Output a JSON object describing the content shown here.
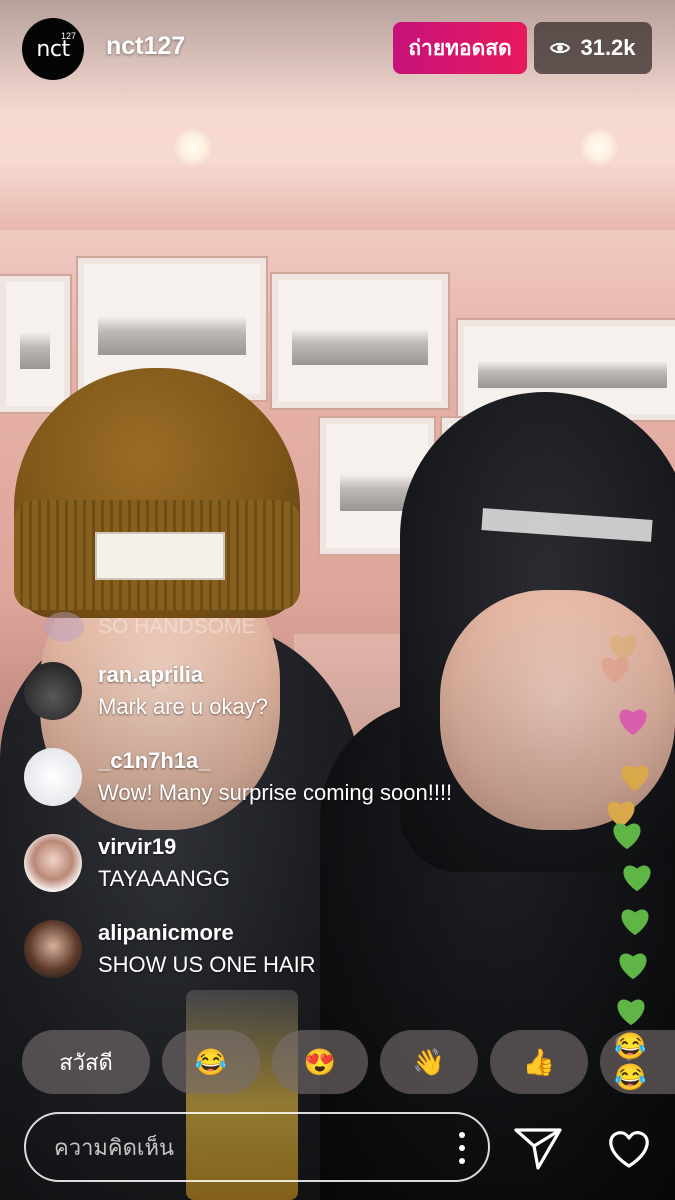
{
  "header": {
    "channel_avatar_text": "nct",
    "channel_avatar_sup": "127",
    "username": "nct127",
    "live_label": "ถ่ายทอดสด",
    "viewer_count": "31.2k",
    "viewer_icon": "eye-icon"
  },
  "faded_comment": "SO HANDSOME",
  "comments": [
    {
      "user": "ran.aprilia",
      "text": "Mark are u okay?"
    },
    {
      "user": "_c1n7h1a_",
      "text": "Wow! Many surprise coming soon!!!!"
    },
    {
      "user": "virvir19",
      "text": "TAYAAANGG"
    },
    {
      "user": "alipanicmore",
      "text": "SHOW US ONE HAIR"
    }
  ],
  "quick_replies": {
    "greeting": "สวัสดี",
    "emojis": [
      "😂",
      "😍",
      "👋",
      "👍",
      "😂😂"
    ]
  },
  "comment_input": {
    "placeholder": "ความคิดเห็น"
  },
  "colors": {
    "live_badge": "#e0126f",
    "heart_green": "#5fb545",
    "heart_blue": "#3d8fe8",
    "heart_pink": "#d95fae",
    "heart_gold": "#d9a84a"
  },
  "floating_hearts": [
    "gold",
    "pink",
    "gold",
    "gold",
    "green",
    "green",
    "green",
    "green",
    "green",
    "blue"
  ]
}
